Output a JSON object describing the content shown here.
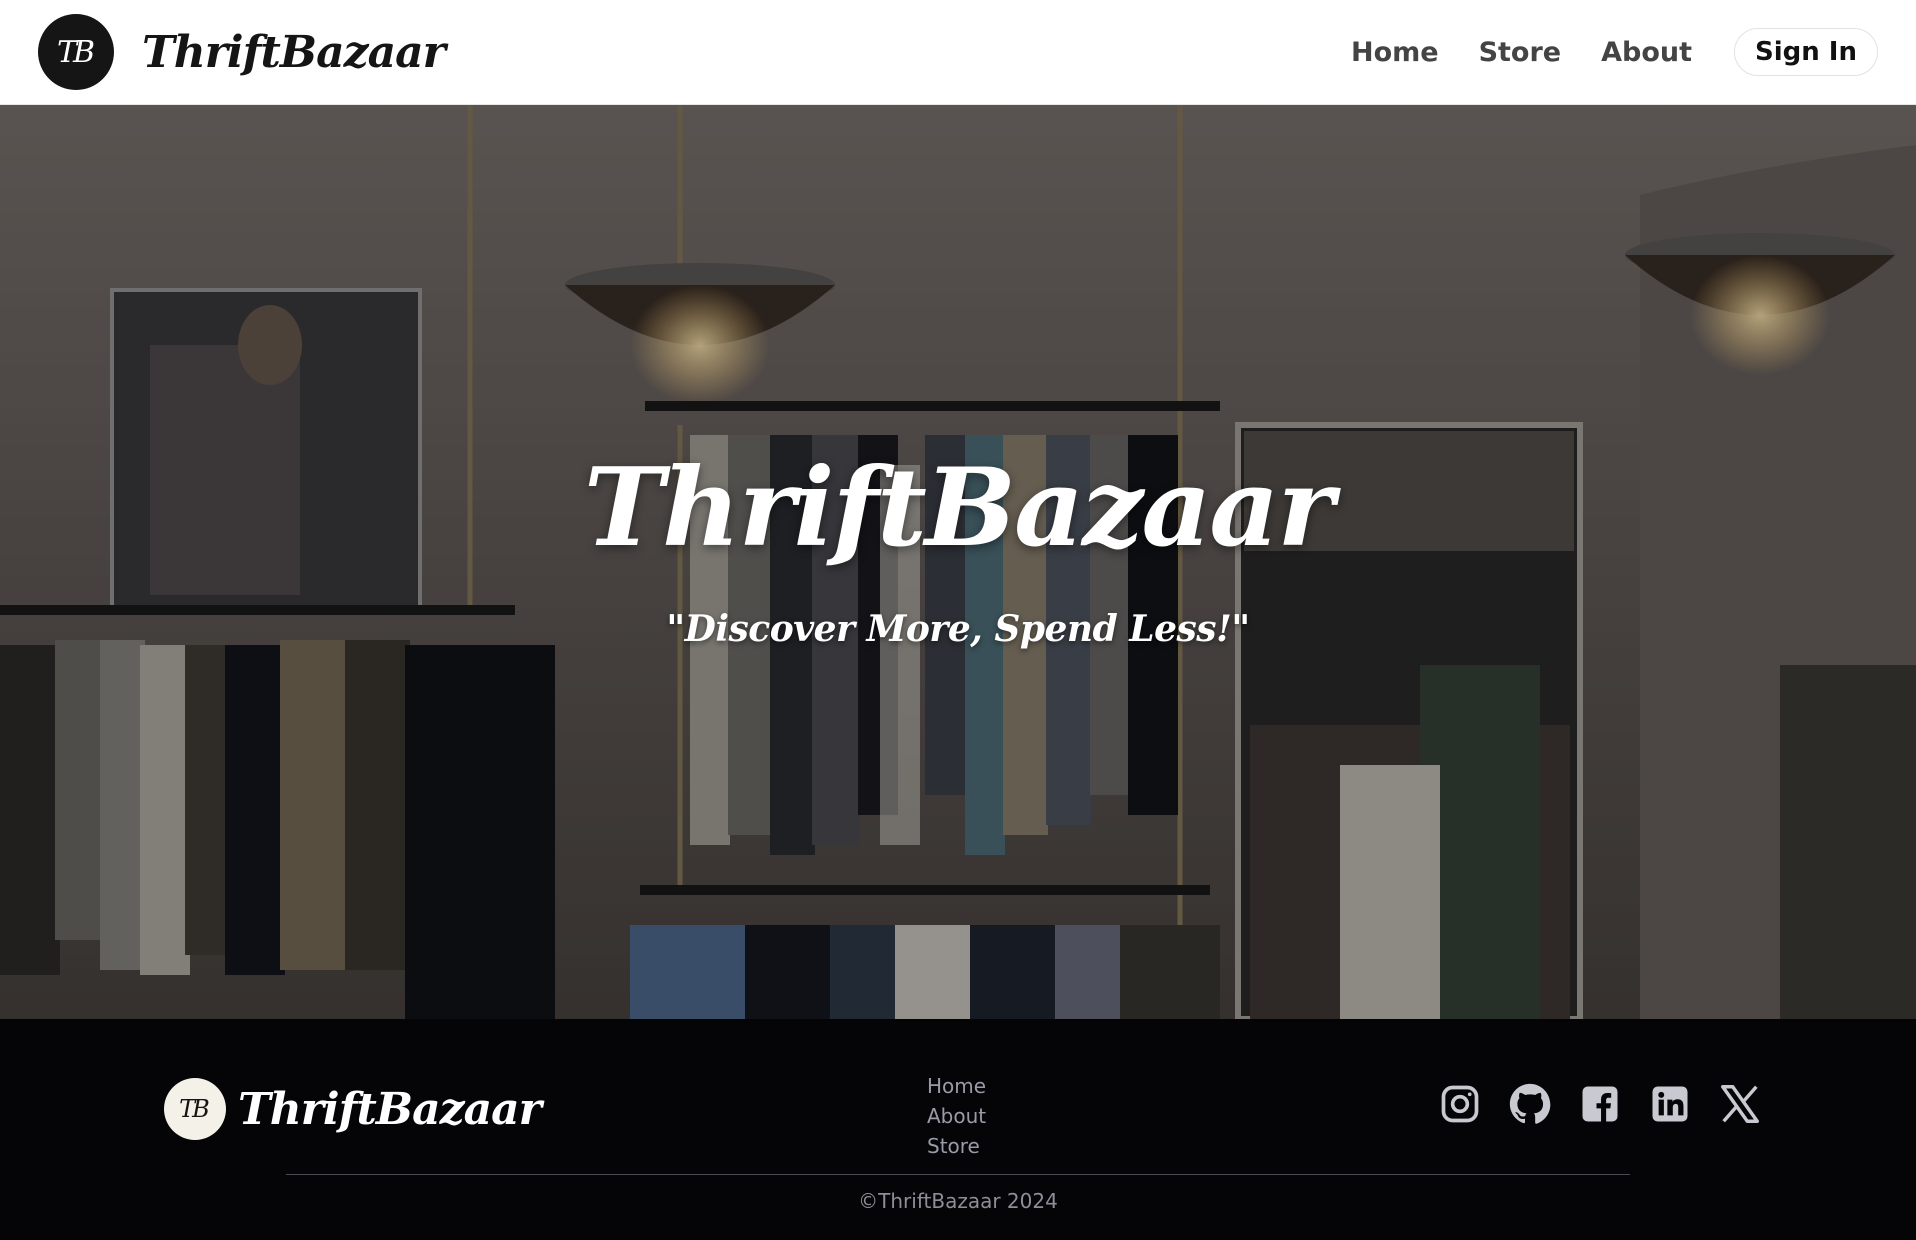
{
  "navbar": {
    "logo_monogram": "TB",
    "brand": "ThriftBazaar",
    "links": [
      "Home",
      "Store",
      "About"
    ],
    "signin_label": "Sign In"
  },
  "hero": {
    "title": "ThriftBazaar",
    "tagline": "\"Discover More, Spend Less!\""
  },
  "footer": {
    "logo_monogram": "TB",
    "brand": "ThriftBazaar",
    "links": [
      "Home",
      "About",
      "Store"
    ],
    "socials": [
      "instagram-icon",
      "github-icon",
      "facebook-icon",
      "linkedin-icon",
      "x-icon"
    ],
    "copyright": "©ThriftBazaar 2024"
  },
  "colors": {
    "navbar_bg": "#ffffff",
    "nav_text": "#444444",
    "footer_bg": "#050507",
    "footer_link": "#9a9aa8",
    "social_icon": "#c9c9d2"
  }
}
